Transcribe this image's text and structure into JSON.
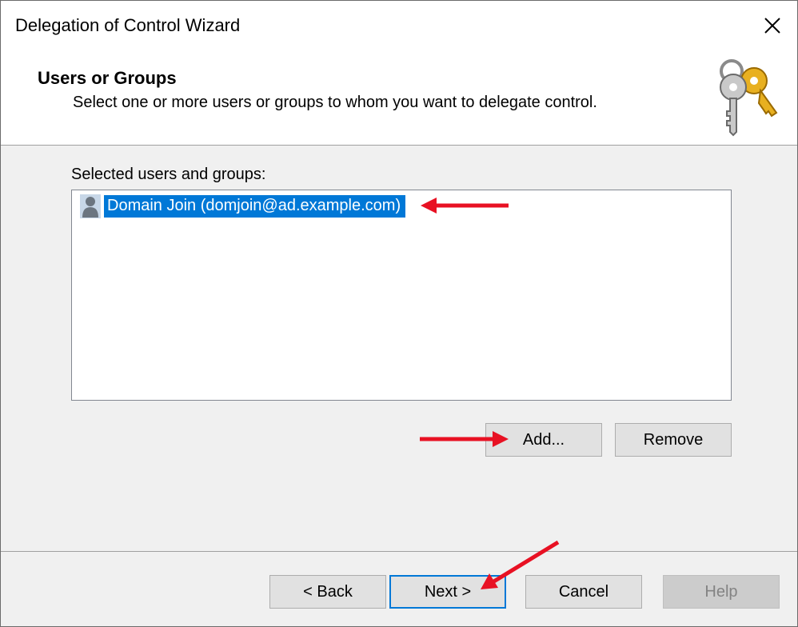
{
  "window": {
    "title": "Delegation of Control Wizard",
    "close_glyph": "✕"
  },
  "header": {
    "title": "Users or Groups",
    "subtitle": "Select one or more users or groups to whom you want to delegate control.",
    "icon": "keys-icon"
  },
  "list": {
    "label": "Selected users and groups:",
    "items": [
      {
        "label": "Domain Join (domjoin@ad.example.com)",
        "icon": "user-icon",
        "selected": true
      }
    ]
  },
  "list_buttons": {
    "add": "Add...",
    "remove": "Remove"
  },
  "footer_buttons": {
    "back": "< Back",
    "next": "Next >",
    "cancel": "Cancel",
    "help": "Help"
  },
  "colors": {
    "selection": "#0078d7",
    "annotation_arrow": "#e81123"
  }
}
